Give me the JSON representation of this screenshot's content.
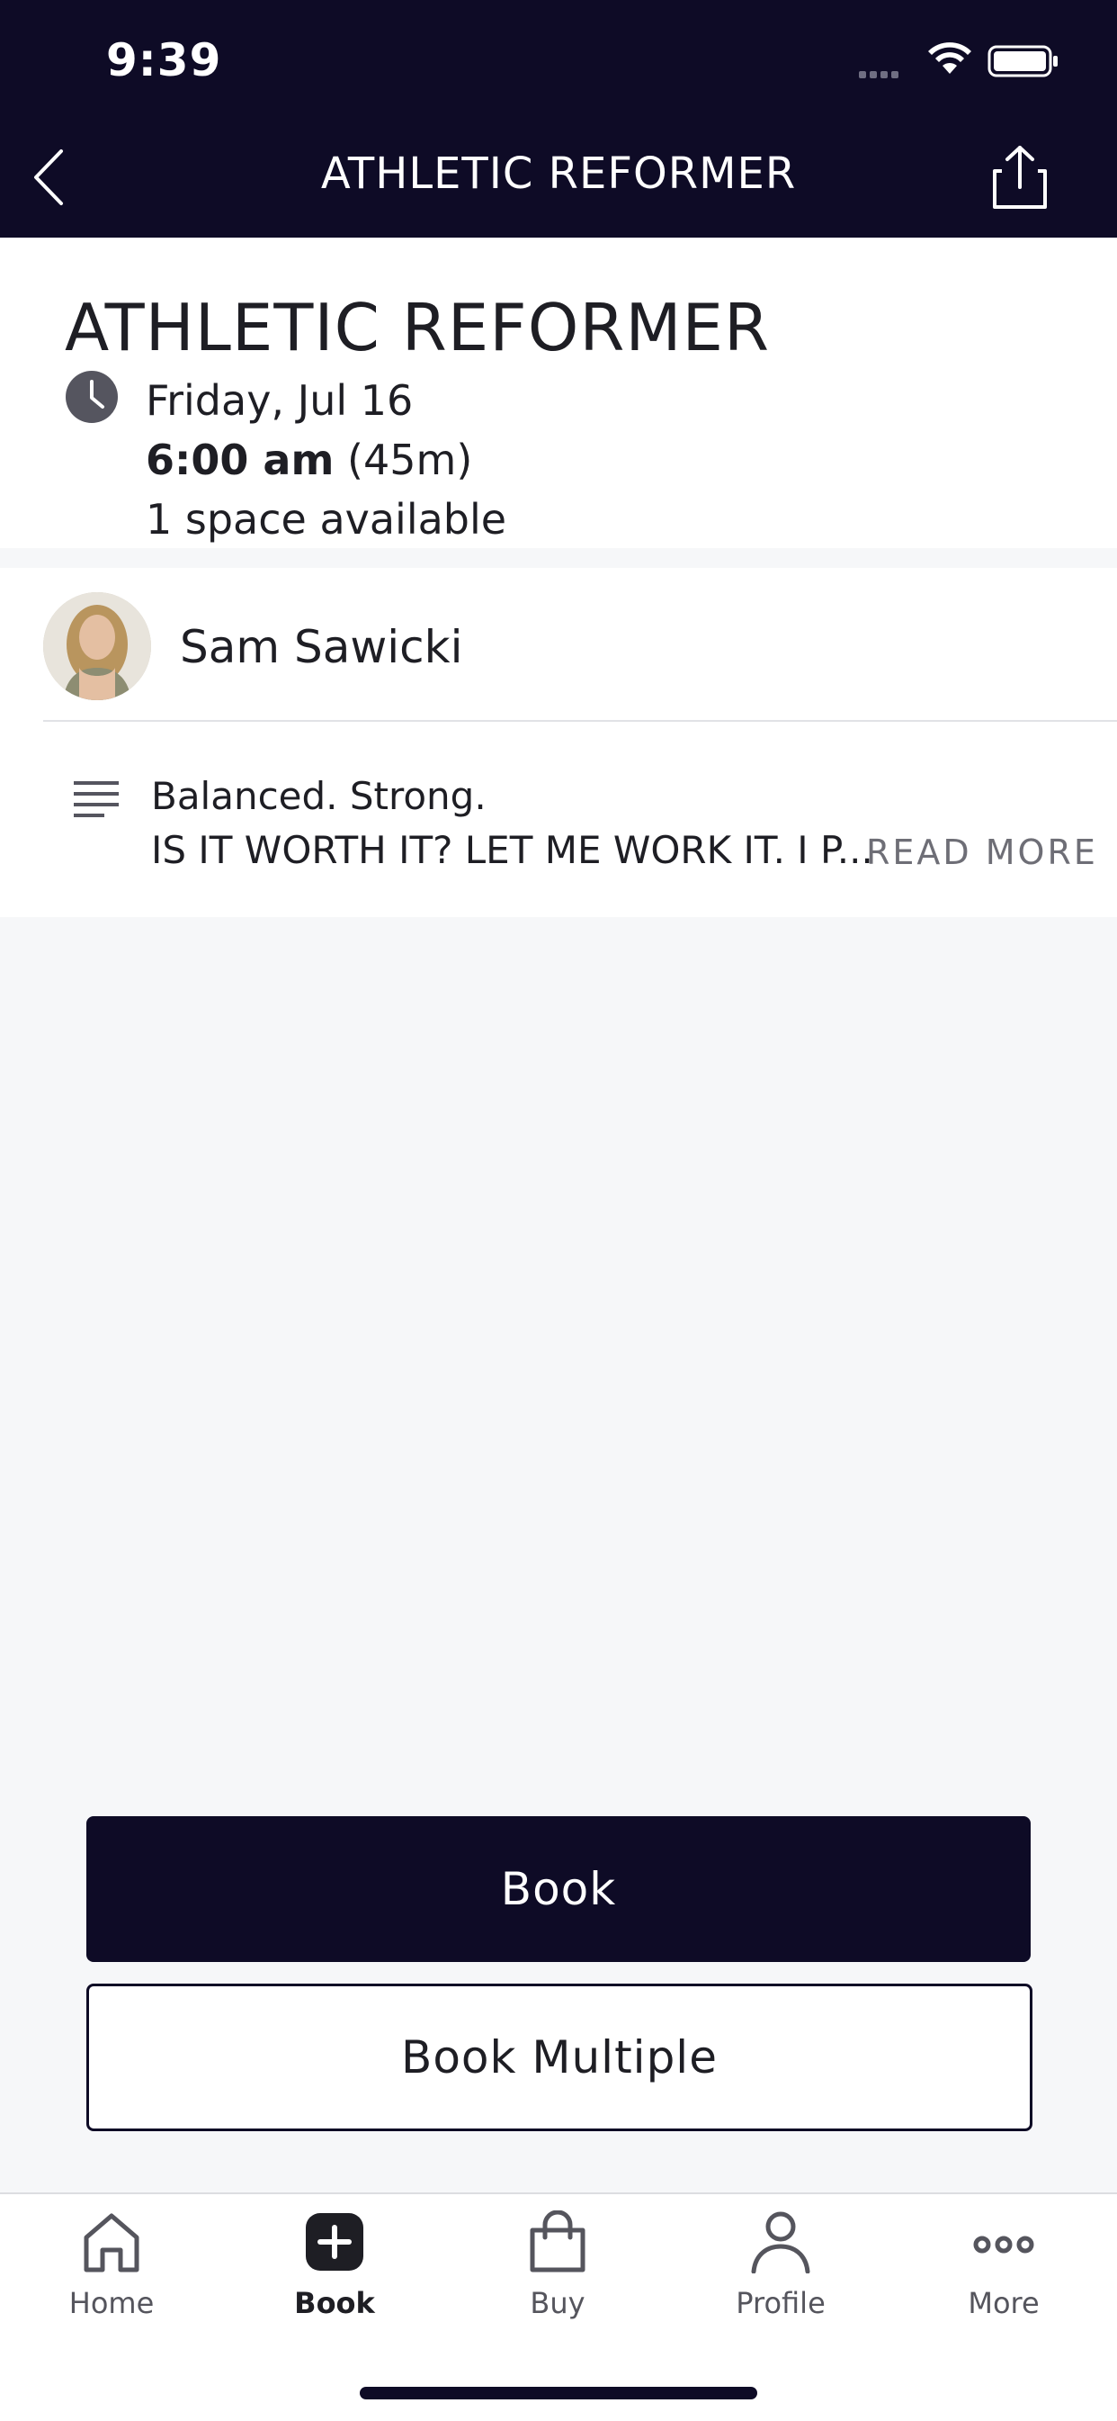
{
  "status_bar": {
    "time": "9:39"
  },
  "nav": {
    "title": "ATHLETIC REFORMER",
    "back_icon": "chevron-left-icon",
    "share_icon": "share-icon"
  },
  "class_info": {
    "title": "ATHLETIC REFORMER",
    "date": "Friday, Jul 16",
    "start_time": "6:00 am",
    "duration": "(45m)",
    "availability": "1 space available"
  },
  "instructor": {
    "name": "Sam Sawicki"
  },
  "description": {
    "line1": "Balanced. Strong.",
    "line2": "IS IT WORTH IT? LET ME WORK IT. I P...",
    "read_more_label": "READ MORE"
  },
  "actions": {
    "book_label": "Book",
    "book_multiple_label": "Book Multiple"
  },
  "tabbar": {
    "items": [
      {
        "label": "Home",
        "icon": "home-icon",
        "active": false
      },
      {
        "label": "Book",
        "icon": "plus-square-icon",
        "active": true
      },
      {
        "label": "Buy",
        "icon": "shopping-bag-icon",
        "active": false
      },
      {
        "label": "Profile",
        "icon": "person-icon",
        "active": false
      },
      {
        "label": "More",
        "icon": "more-dots-icon",
        "active": false
      }
    ]
  },
  "colors": {
    "brand_dark": "#0e0b26",
    "background": "#f6f7f9",
    "text": "#1e1e24",
    "muted": "#6e6e76"
  }
}
